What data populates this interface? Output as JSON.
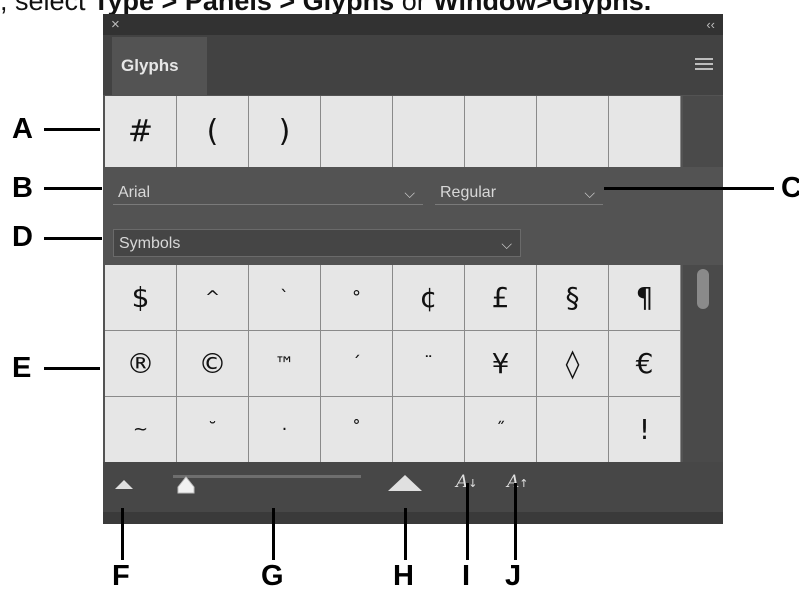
{
  "caption": {
    "prefix": ", select ",
    "path1": "Type > Panels > Glyphs",
    "joiner": " or ",
    "path2": "Window>Glyphs."
  },
  "panel": {
    "close_glyph": "×",
    "collapse_glyph": "‹‹",
    "tab_label": "Glyphs",
    "menu_icon": "hamburger-menu-icon"
  },
  "recent_glyphs": [
    "#",
    "(",
    ")",
    "",
    "",
    "",
    "",
    ""
  ],
  "font_family": {
    "value": "Arial",
    "chevron": "⌵"
  },
  "font_style": {
    "value": "Regular",
    "chevron": "⌵"
  },
  "glyph_set": {
    "value": "Symbols",
    "chevron": "⌵"
  },
  "glyph_grid": [
    [
      "$",
      "^",
      "`",
      "°",
      "¢",
      "£",
      "§",
      "¶"
    ],
    [
      "®",
      "©",
      "™",
      "´",
      "¨",
      "¥",
      "◊",
      "€"
    ],
    [
      "~",
      "˘",
      "·",
      "˚",
      "",
      "˝",
      "",
      "!"
    ]
  ],
  "bottom_bar": {
    "decrease_size_label": "A",
    "decrease_arrow": "↓",
    "increase_size_label": "A",
    "increase_arrow": "↑"
  },
  "callouts": {
    "A": "A",
    "B": "B",
    "C": "C",
    "D": "D",
    "E": "E",
    "F": "F",
    "G": "G",
    "H": "H",
    "I": "I",
    "J": "J"
  },
  "colors": {
    "panel_bg": "#535353",
    "cell_bg": "#e6e6e6",
    "tab_strip": "#424242"
  }
}
